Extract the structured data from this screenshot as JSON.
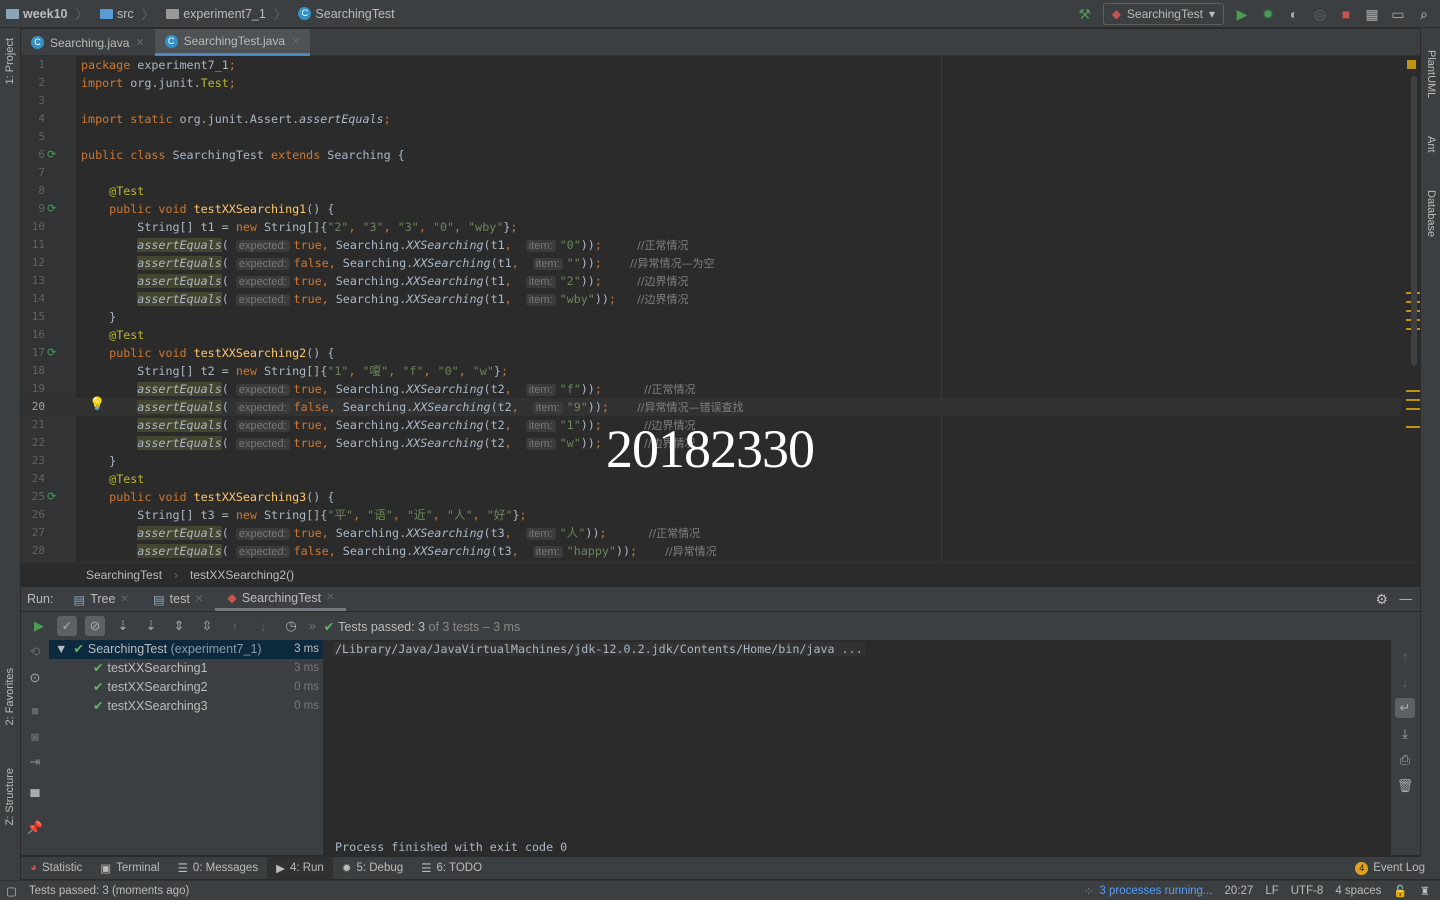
{
  "navbar": {
    "crumbs": [
      "week10",
      "src",
      "experiment7_1",
      "SearchingTest"
    ],
    "run_config": "SearchingTest"
  },
  "left_strip": {
    "project": "1: Project",
    "favorites": "2: Favorites",
    "structure": "Z: Structure"
  },
  "right_strip": {
    "plantuml": "PlantUML",
    "ant": "Ant",
    "database": "Database"
  },
  "tabs": [
    {
      "label": "Searching.java",
      "active": false
    },
    {
      "label": "SearchingTest.java",
      "active": true
    }
  ],
  "editor": {
    "current_line": 20,
    "lines": [
      [
        [
          "kw",
          "package "
        ],
        [
          "pl",
          "experiment7_1"
        ],
        [
          "kw",
          ";"
        ]
      ],
      [
        [
          "kw",
          "import "
        ],
        [
          "pl",
          "org.junit."
        ],
        [
          "ann",
          "Test"
        ],
        [
          "kw",
          ";"
        ]
      ],
      [],
      [
        [
          "kw",
          "import static "
        ],
        [
          "pl",
          "org.junit.Assert."
        ],
        [
          "it",
          "assertEquals"
        ],
        [
          "kw",
          ";"
        ]
      ],
      [],
      [
        [
          "kw",
          "public class "
        ],
        [
          "pl",
          "SearchingTest "
        ],
        [
          "kw",
          "extends "
        ],
        [
          "pl",
          "Searching {"
        ]
      ],
      [],
      [
        [
          "pl",
          "    "
        ],
        [
          "ann",
          "@Test"
        ]
      ],
      [
        [
          "pl",
          "    "
        ],
        [
          "kw",
          "public void "
        ],
        [
          "fn",
          "testXXSearching1"
        ],
        [
          "pl",
          "() {"
        ]
      ],
      [
        [
          "pl",
          "        String[] t1 = "
        ],
        [
          "kw",
          "new "
        ],
        [
          "pl",
          "String[]{"
        ],
        [
          "str",
          "\"2\""
        ],
        [
          "kw",
          ", "
        ],
        [
          "str",
          "\"3\""
        ],
        [
          "kw",
          ", "
        ],
        [
          "str",
          "\"3\""
        ],
        [
          "kw",
          ", "
        ],
        [
          "str",
          "\"0\""
        ],
        [
          "kw",
          ", "
        ],
        [
          "str",
          "\"wby\""
        ],
        [
          "pl",
          "}"
        ],
        [
          "kw",
          ";"
        ]
      ],
      [
        [
          "pl",
          "        "
        ],
        [
          "ae",
          "assertEquals"
        ],
        [
          "pl",
          "( "
        ],
        [
          "hint",
          "expected:"
        ],
        [
          "kw",
          "true, "
        ],
        [
          "pl",
          "Searching."
        ],
        [
          "it",
          "XXSearching"
        ],
        [
          "pl",
          "(t1"
        ],
        [
          "kw",
          ",  "
        ],
        [
          "hint",
          "item:"
        ],
        [
          "str",
          "\"0\""
        ],
        [
          "pl",
          "))"
        ],
        [
          "kw",
          ";"
        ],
        [
          "pl",
          "     "
        ],
        [
          "cm",
          "//正常情况"
        ]
      ],
      [
        [
          "pl",
          "        "
        ],
        [
          "ae",
          "assertEquals"
        ],
        [
          "pl",
          "( "
        ],
        [
          "hint",
          "expected:"
        ],
        [
          "kw",
          "false, "
        ],
        [
          "pl",
          "Searching."
        ],
        [
          "it",
          "XXSearching"
        ],
        [
          "pl",
          "(t1"
        ],
        [
          "kw",
          ",  "
        ],
        [
          "hint",
          "item:"
        ],
        [
          "str",
          "\"\""
        ],
        [
          "pl",
          "))"
        ],
        [
          "kw",
          ";"
        ],
        [
          "pl",
          "    "
        ],
        [
          "cm",
          "//异常情况—为空"
        ]
      ],
      [
        [
          "pl",
          "        "
        ],
        [
          "ae",
          "assertEquals"
        ],
        [
          "pl",
          "( "
        ],
        [
          "hint",
          "expected:"
        ],
        [
          "kw",
          "true, "
        ],
        [
          "pl",
          "Searching."
        ],
        [
          "it",
          "XXSearching"
        ],
        [
          "pl",
          "(t1"
        ],
        [
          "kw",
          ",  "
        ],
        [
          "hint",
          "item:"
        ],
        [
          "str",
          "\"2\""
        ],
        [
          "pl",
          "))"
        ],
        [
          "kw",
          ";"
        ],
        [
          "pl",
          "     "
        ],
        [
          "cm",
          "//边界情况"
        ]
      ],
      [
        [
          "pl",
          "        "
        ],
        [
          "ae",
          "assertEquals"
        ],
        [
          "pl",
          "( "
        ],
        [
          "hint",
          "expected:"
        ],
        [
          "kw",
          "true, "
        ],
        [
          "pl",
          "Searching."
        ],
        [
          "it",
          "XXSearching"
        ],
        [
          "pl",
          "(t1"
        ],
        [
          "kw",
          ",  "
        ],
        [
          "hint",
          "item:"
        ],
        [
          "str",
          "\"wby\""
        ],
        [
          "pl",
          "))"
        ],
        [
          "kw",
          ";"
        ],
        [
          "pl",
          "   "
        ],
        [
          "cm",
          "//边界情况"
        ]
      ],
      [
        [
          "pl",
          "    }"
        ]
      ],
      [
        [
          "pl",
          "    "
        ],
        [
          "ann",
          "@Test"
        ]
      ],
      [
        [
          "pl",
          "    "
        ],
        [
          "kw",
          "public void "
        ],
        [
          "fn",
          "testXXSearching2"
        ],
        [
          "pl",
          "() {"
        ]
      ],
      [
        [
          "pl",
          "        String[] t2 = "
        ],
        [
          "kw",
          "new "
        ],
        [
          "pl",
          "String[]{"
        ],
        [
          "str",
          "\"1\""
        ],
        [
          "kw",
          ", "
        ],
        [
          "str",
          "\"嗄\""
        ],
        [
          "kw",
          ", "
        ],
        [
          "str",
          "\"f\""
        ],
        [
          "kw",
          ", "
        ],
        [
          "str",
          "\"0\""
        ],
        [
          "kw",
          ", "
        ],
        [
          "str",
          "\"w\""
        ],
        [
          "pl",
          "}"
        ],
        [
          "kw",
          ";"
        ]
      ],
      [
        [
          "pl",
          "        "
        ],
        [
          "ae",
          "assertEquals"
        ],
        [
          "pl",
          "( "
        ],
        [
          "hint",
          "expected:"
        ],
        [
          "kw",
          "true, "
        ],
        [
          "pl",
          "Searching."
        ],
        [
          "it",
          "XXSearching"
        ],
        [
          "pl",
          "(t2"
        ],
        [
          "kw",
          ",  "
        ],
        [
          "hint",
          "item:"
        ],
        [
          "str",
          "\"f\""
        ],
        [
          "pl",
          "))"
        ],
        [
          "kw",
          ";"
        ],
        [
          "pl",
          "      "
        ],
        [
          "cm",
          "//正常情况"
        ]
      ],
      [
        [
          "pl",
          "        "
        ],
        [
          "ae",
          "assertEquals"
        ],
        [
          "pl",
          "( "
        ],
        [
          "hint",
          "expected:"
        ],
        [
          "kw",
          "false, "
        ],
        [
          "pl",
          "Searching."
        ],
        [
          "it",
          "XXSearching"
        ],
        [
          "pl",
          "(t2"
        ],
        [
          "kw",
          ",  "
        ],
        [
          "hint",
          "item:"
        ],
        [
          "str",
          "\"9\""
        ],
        [
          "pl",
          "))"
        ],
        [
          "kw",
          ";"
        ],
        [
          "pl",
          "    "
        ],
        [
          "cm",
          "//异常情况—错误查找"
        ]
      ],
      [
        [
          "pl",
          "        "
        ],
        [
          "ae",
          "assertEquals"
        ],
        [
          "pl",
          "( "
        ],
        [
          "hint",
          "expected:"
        ],
        [
          "kw",
          "true, "
        ],
        [
          "pl",
          "Searching."
        ],
        [
          "it",
          "XXSearching"
        ],
        [
          "pl",
          "(t2"
        ],
        [
          "kw",
          ",  "
        ],
        [
          "hint",
          "item:"
        ],
        [
          "str",
          "\"1\""
        ],
        [
          "pl",
          "))"
        ],
        [
          "kw",
          ";"
        ],
        [
          "pl",
          "      "
        ],
        [
          "cm",
          "//边界情况"
        ]
      ],
      [
        [
          "pl",
          "        "
        ],
        [
          "ae",
          "assertEquals"
        ],
        [
          "pl",
          "( "
        ],
        [
          "hint",
          "expected:"
        ],
        [
          "kw",
          "true, "
        ],
        [
          "pl",
          "Searching."
        ],
        [
          "it",
          "XXSearching"
        ],
        [
          "pl",
          "(t2"
        ],
        [
          "kw",
          ",  "
        ],
        [
          "hint",
          "item:"
        ],
        [
          "str",
          "\"w\""
        ],
        [
          "pl",
          "))"
        ],
        [
          "kw",
          ";"
        ],
        [
          "pl",
          "      "
        ],
        [
          "cm",
          "//边界情况"
        ]
      ],
      [
        [
          "pl",
          "    }"
        ]
      ],
      [
        [
          "pl",
          "    "
        ],
        [
          "ann",
          "@Test"
        ]
      ],
      [
        [
          "pl",
          "    "
        ],
        [
          "kw",
          "public void "
        ],
        [
          "fn",
          "testXXSearching3"
        ],
        [
          "pl",
          "() {"
        ]
      ],
      [
        [
          "pl",
          "        String[] t3 = "
        ],
        [
          "kw",
          "new "
        ],
        [
          "pl",
          "String[]{"
        ],
        [
          "str",
          "\"平\""
        ],
        [
          "kw",
          ", "
        ],
        [
          "str",
          "\"语\""
        ],
        [
          "kw",
          ", "
        ],
        [
          "str",
          "\"近\""
        ],
        [
          "kw",
          ", "
        ],
        [
          "str",
          "\"人\""
        ],
        [
          "kw",
          ", "
        ],
        [
          "str",
          "\"好\""
        ],
        [
          "pl",
          "}"
        ],
        [
          "kw",
          ";"
        ]
      ],
      [
        [
          "pl",
          "        "
        ],
        [
          "ae",
          "assertEquals"
        ],
        [
          "pl",
          "( "
        ],
        [
          "hint",
          "expected:"
        ],
        [
          "kw",
          "true, "
        ],
        [
          "pl",
          "Searching."
        ],
        [
          "it",
          "XXSearching"
        ],
        [
          "pl",
          "(t3"
        ],
        [
          "kw",
          ",  "
        ],
        [
          "hint",
          "item:"
        ],
        [
          "str",
          "\"人\""
        ],
        [
          "pl",
          "))"
        ],
        [
          "kw",
          ";"
        ],
        [
          "pl",
          "      "
        ],
        [
          "cm",
          "//正常情况"
        ]
      ],
      [
        [
          "pl",
          "        "
        ],
        [
          "ae",
          "assertEquals"
        ],
        [
          "pl",
          "( "
        ],
        [
          "hint",
          "expected:"
        ],
        [
          "kw",
          "false, "
        ],
        [
          "pl",
          "Searching."
        ],
        [
          "it",
          "XXSearching"
        ],
        [
          "pl",
          "(t3"
        ],
        [
          "kw",
          ",  "
        ],
        [
          "hint",
          "item:"
        ],
        [
          "str",
          "\"happy\""
        ],
        [
          "pl",
          "))"
        ],
        [
          "kw",
          ";"
        ],
        [
          "pl",
          "    "
        ],
        [
          "cm",
          "//异常情况"
        ]
      ]
    ],
    "run_gutter_lines": [
      6,
      9,
      17,
      25
    ],
    "watermark": "20182330"
  },
  "breadcrumb": [
    "SearchingTest",
    "testXXSearching2()"
  ],
  "run": {
    "label": "Run:",
    "tabs": [
      {
        "label": "Tree"
      },
      {
        "label": "test"
      },
      {
        "label": "SearchingTest",
        "active": true
      }
    ],
    "summary": {
      "prefix": "Tests passed: ",
      "passed": "3",
      "suffix": " of 3 tests – 3 ms"
    },
    "tree": [
      {
        "name": "SearchingTest",
        "module": "(experiment7_1)",
        "time": "3 ms",
        "root": true
      },
      {
        "name": "testXXSearching1",
        "time": "3 ms"
      },
      {
        "name": "testXXSearching2",
        "time": "0 ms"
      },
      {
        "name": "testXXSearching3",
        "time": "0 ms"
      }
    ],
    "console": {
      "command": "/Library/Java/JavaVirtualMachines/jdk-12.0.2.jdk/Contents/Home/bin/java ...",
      "exit": "Process finished with exit code 0"
    }
  },
  "toolwindows": [
    {
      "label": "Statistic"
    },
    {
      "label": "Terminal"
    },
    {
      "label": "0: Messages"
    },
    {
      "label": "4: Run",
      "active": true
    },
    {
      "label": "5: Debug"
    },
    {
      "label": "6: TODO"
    }
  ],
  "event_log": {
    "label": "Event Log",
    "count": "4"
  },
  "status": {
    "message": "Tests passed: 3 (moments ago)",
    "processes": "3 processes running...",
    "position": "20:27",
    "line_sep": "LF",
    "encoding": "UTF-8",
    "indent": "4 spaces"
  },
  "colors": {
    "accent": "#4a88c7",
    "pass": "#5fb760",
    "keyword": "#cc7832",
    "string": "#6a8759"
  }
}
